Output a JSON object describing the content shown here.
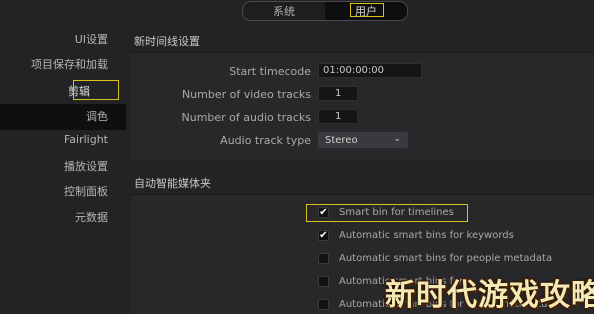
{
  "tabs": [
    "系统",
    "用户"
  ],
  "sidebar": {
    "items": [
      "UI设置",
      "项目保存和加载",
      "剪辑",
      "调色",
      "Fairlight",
      "播放设置",
      "控制面板",
      "元数据"
    ],
    "active_index": 2
  },
  "timeline_settings": {
    "title": "新时间线设置",
    "start_timecode_label": "Start timecode",
    "start_timecode_value": "01:00:00:00",
    "video_tracks_label": "Number of video tracks",
    "video_tracks_value": "1",
    "audio_tracks_label": "Number of audio tracks",
    "audio_tracks_value": "1",
    "audio_track_type_label": "Audio track type",
    "audio_track_type_value": "Stereo"
  },
  "smart_bins": {
    "title": "自动智能媒体夹",
    "options": [
      {
        "label": "Smart bin for timelines",
        "checked": true
      },
      {
        "label": "Automatic smart bins for keywords",
        "checked": true
      },
      {
        "label": "Automatic smart bins for people metadata",
        "checked": false
      },
      {
        "label": "Automatic smart bins for ...",
        "checked": false
      },
      {
        "label": "Automatic smart bins for scene metadata",
        "checked": false
      }
    ]
  },
  "watermark": "新时代游戏攻略",
  "colors": {
    "highlight": "#d8c21f",
    "background": "#232326",
    "panel": "#28282b"
  }
}
